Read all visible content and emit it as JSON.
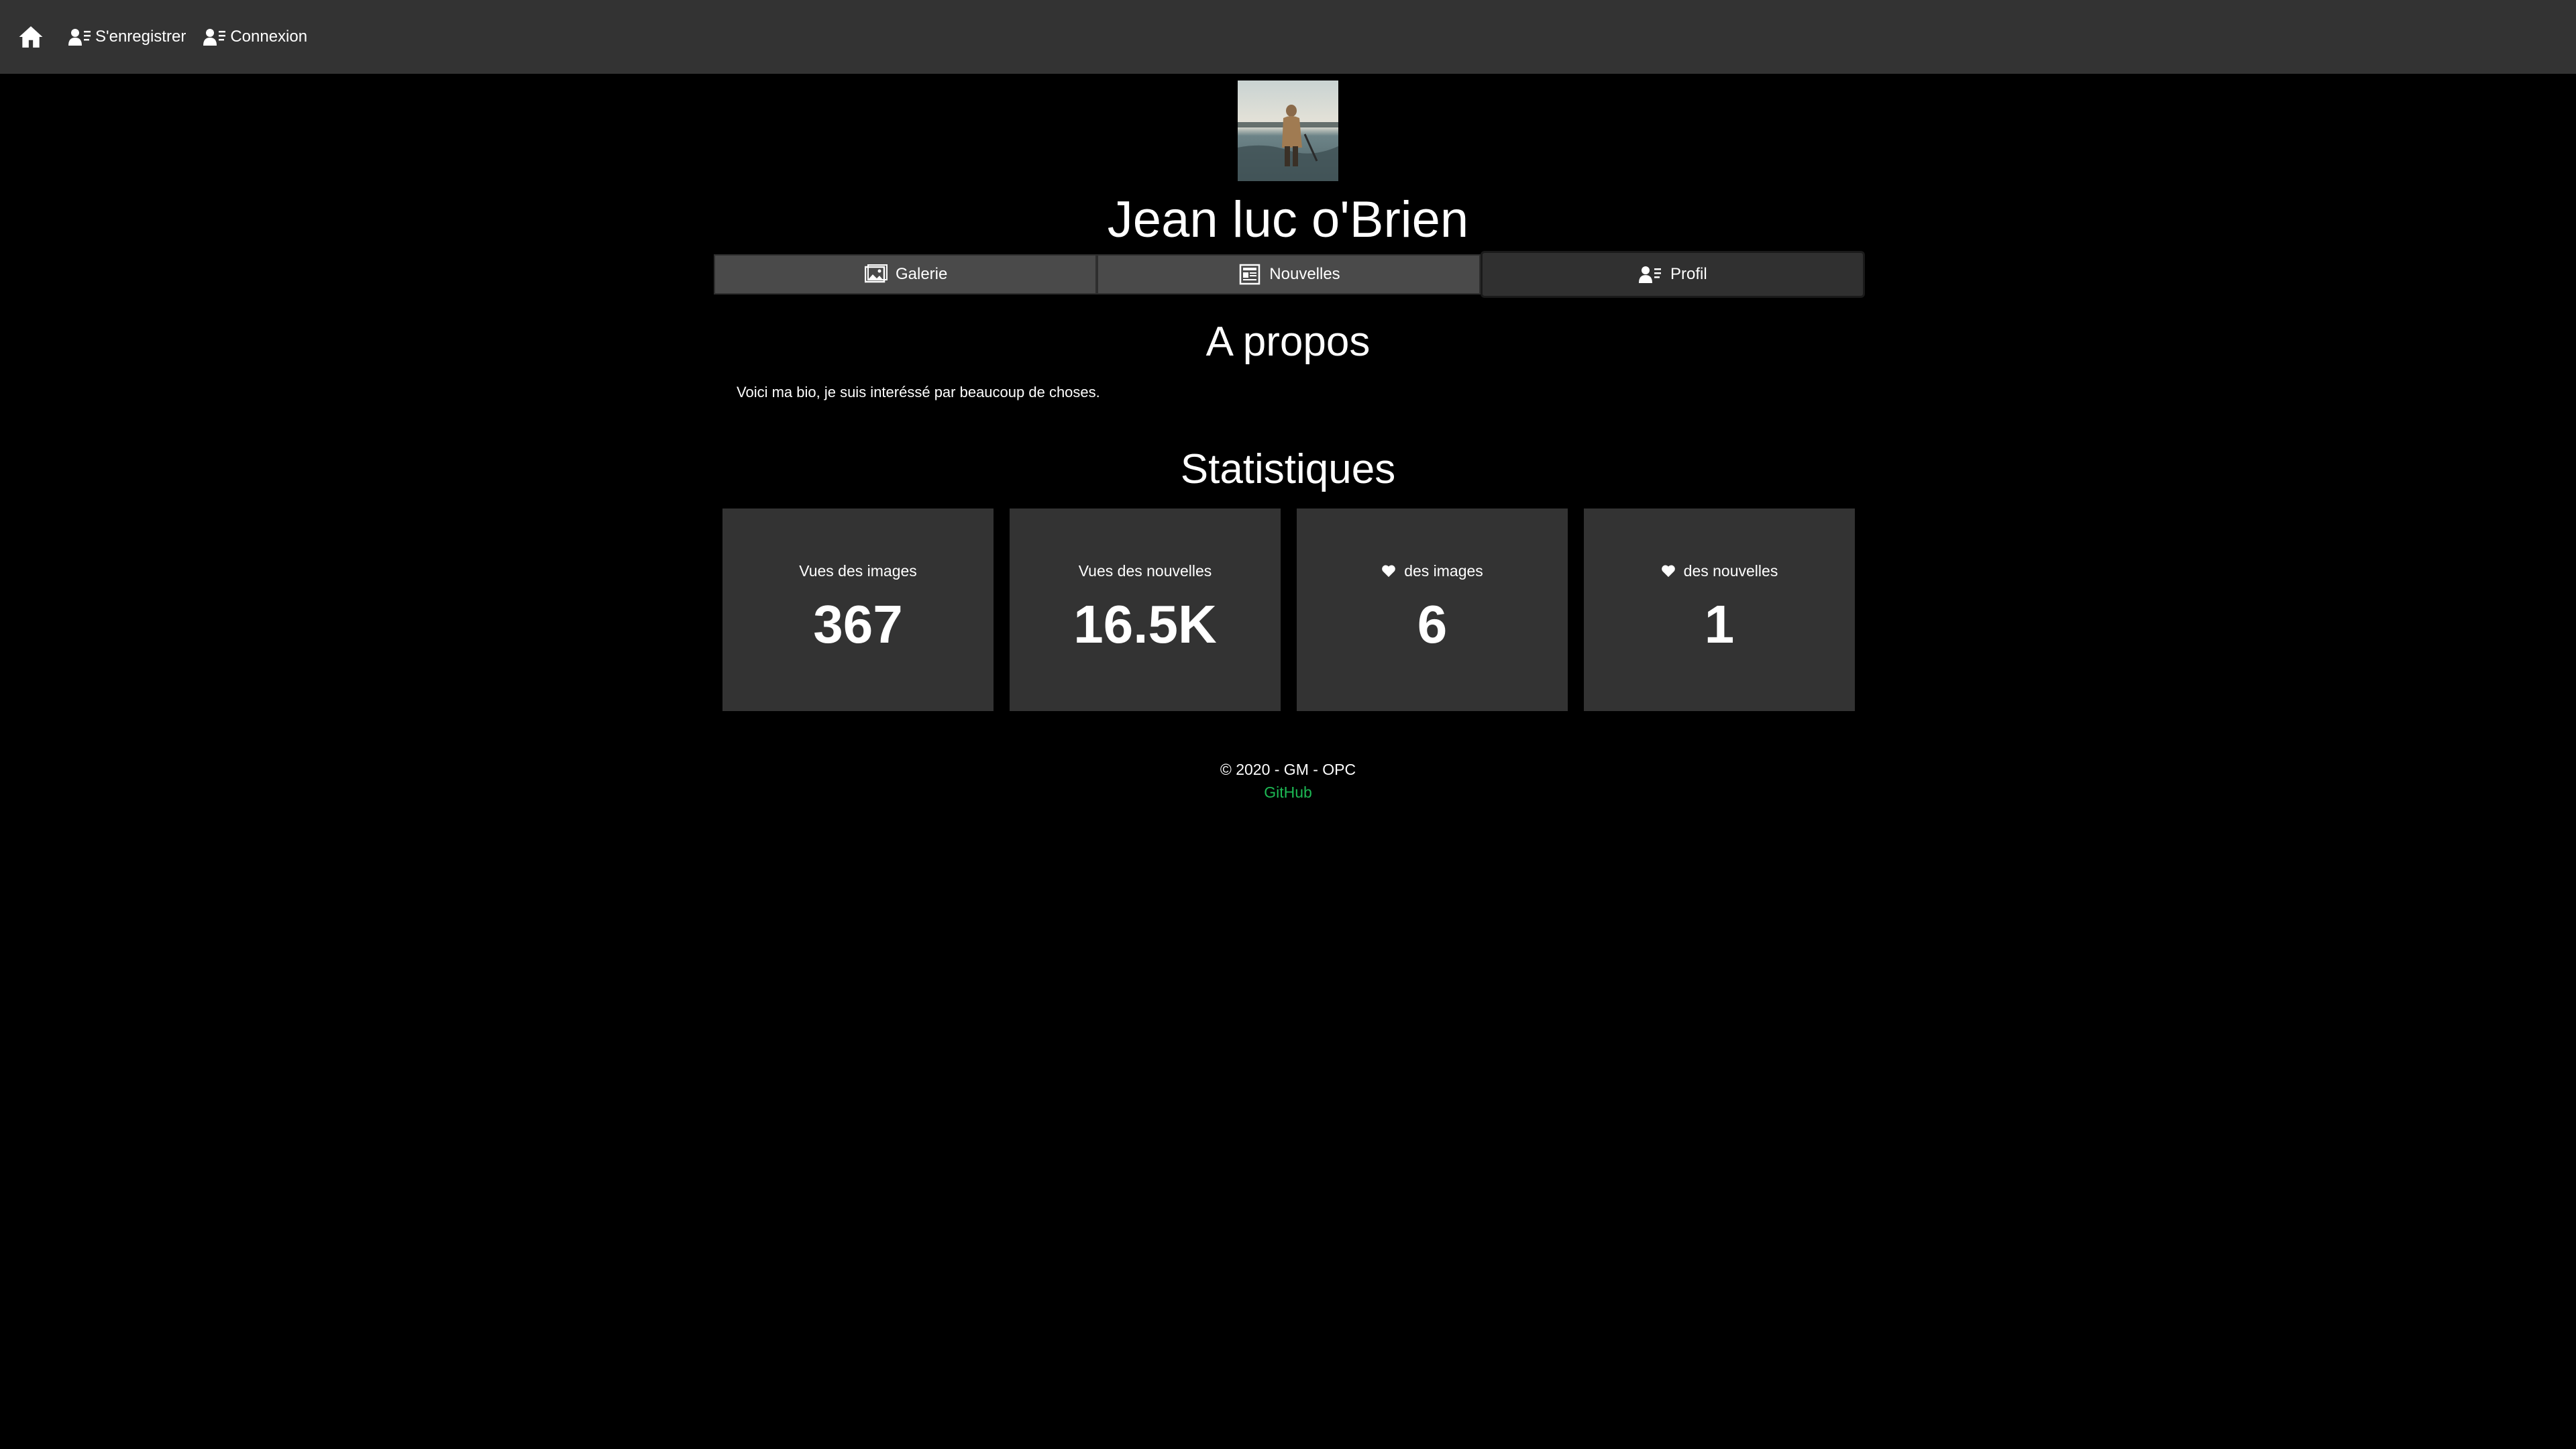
{
  "nav": {
    "home_icon": "home-icon",
    "register_label": "S'enregistrer",
    "register_icon": "user-list-icon",
    "login_label": "Connexion",
    "login_icon": "user-list-icon"
  },
  "profile": {
    "name": "Jean luc o'Brien",
    "avatar": "avatar-photo"
  },
  "tabs": [
    {
      "label": "Galerie",
      "icon": "gallery-icon",
      "active": false
    },
    {
      "label": "Nouvelles",
      "icon": "newspaper-icon",
      "active": false
    },
    {
      "label": "Profil",
      "icon": "user-list-icon",
      "active": true
    }
  ],
  "about": {
    "title": "A propos",
    "bio": "Voici ma bio, je suis interéssé par beaucoup de choses."
  },
  "stats": {
    "title": "Statistiques",
    "items": [
      {
        "label": "Vues des images",
        "value": "367",
        "icon": ""
      },
      {
        "label": "Vues des nouvelles",
        "value": "16.5K",
        "icon": ""
      },
      {
        "label": "des images",
        "value": "6",
        "icon": "heart-icon"
      },
      {
        "label": "des nouvelles",
        "value": "1",
        "icon": "heart-icon"
      }
    ]
  },
  "footer": {
    "copyright": "© 2020 - GM - OPC",
    "link": "GitHub"
  },
  "colors": {
    "background": "#000000",
    "navbar": "#333333",
    "card": "#333333",
    "link": "#1db954"
  }
}
